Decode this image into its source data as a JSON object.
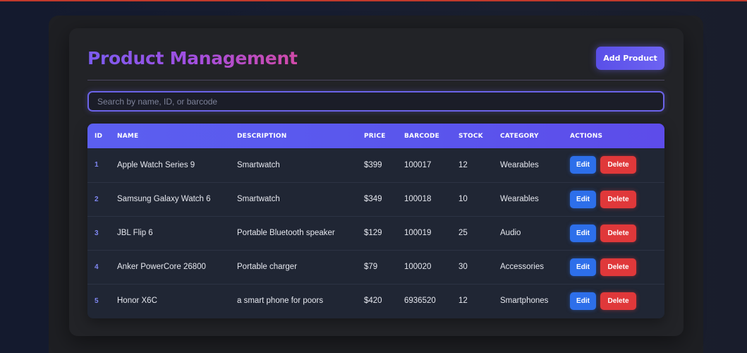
{
  "header": {
    "title": "Product Management",
    "add_label": "Add Product"
  },
  "search": {
    "placeholder": "Search by name, ID, or barcode"
  },
  "table": {
    "columns": [
      "ID",
      "NAME",
      "DESCRIPTION",
      "PRICE",
      "BARCODE",
      "STOCK",
      "CATEGORY",
      "ACTIONS"
    ],
    "edit_label": "Edit",
    "delete_label": "Delete",
    "rows": [
      {
        "id": "1",
        "name": "Apple Watch Series 9",
        "description": "Smartwatch",
        "price": "$399",
        "barcode": "100017",
        "stock": "12",
        "category": "Wearables"
      },
      {
        "id": "2",
        "name": "Samsung Galaxy Watch 6",
        "description": "Smartwatch",
        "price": "$349",
        "barcode": "100018",
        "stock": "10",
        "category": "Wearables"
      },
      {
        "id": "3",
        "name": "JBL Flip 6",
        "description": "Portable Bluetooth speaker",
        "price": "$129",
        "barcode": "100019",
        "stock": "25",
        "category": "Audio"
      },
      {
        "id": "4",
        "name": "Anker PowerCore 26800",
        "description": "Portable charger",
        "price": "$79",
        "barcode": "100020",
        "stock": "30",
        "category": "Accessories"
      },
      {
        "id": "5",
        "name": "Honor X6C",
        "description": "a smart phone for poors",
        "price": "$420",
        "barcode": "6936520",
        "stock": "12",
        "category": "Smartphones"
      }
    ]
  },
  "colors": {
    "accent": "#5b5ff0",
    "edit": "#2d6fea",
    "delete": "#e0383a",
    "card": "#222327"
  }
}
